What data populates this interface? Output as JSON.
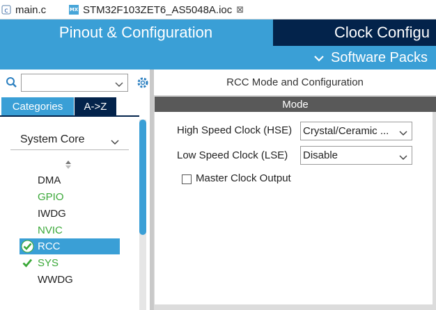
{
  "tabs": [
    {
      "label": "main.c",
      "icon": "c-source-file-icon"
    },
    {
      "label": "STM32F103ZET6_AS5048A.ioc",
      "icon": "mx-file-icon",
      "badge": "MX",
      "close": "⊠"
    }
  ],
  "header": {
    "tabs": [
      {
        "label": "Pinout & Configuration",
        "active": true
      },
      {
        "label": "Clock Configu",
        "active": false
      }
    ],
    "software_packs": "Software Packs"
  },
  "left_panel": {
    "search": {
      "value": "",
      "placeholder": ""
    },
    "category_tabs": [
      {
        "label": "Categories",
        "active": true
      },
      {
        "label": "A->Z",
        "active": false
      }
    ],
    "group": "System Core",
    "items": [
      {
        "label": "DMA",
        "color": "#222222",
        "checked": false,
        "selected": false
      },
      {
        "label": "GPIO",
        "color": "#3aa838",
        "checked": false,
        "selected": false
      },
      {
        "label": "IWDG",
        "color": "#222222",
        "checked": false,
        "selected": false
      },
      {
        "label": "NVIC",
        "color": "#3aa838",
        "checked": false,
        "selected": false
      },
      {
        "label": "RCC",
        "color": "#ffffff",
        "checked": true,
        "selected": true
      },
      {
        "label": "SYS",
        "color": "#3aa838",
        "checked": true,
        "selected": false
      },
      {
        "label": "WWDG",
        "color": "#222222",
        "checked": false,
        "selected": false
      }
    ]
  },
  "right_panel": {
    "title": "RCC Mode and Configuration",
    "section": "Mode",
    "fields": [
      {
        "label": "High Speed Clock (HSE)",
        "value": "Crystal/Ceramic ..."
      },
      {
        "label": "Low Speed Clock (LSE)",
        "value": "Disable"
      }
    ],
    "checkbox": {
      "label": "Master Clock Output",
      "checked": false
    }
  },
  "colors": {
    "accent_blue": "#3a9fd6",
    "navy": "#03234b",
    "enabled_green": "#3aa838",
    "mode_bar": "#595959"
  }
}
